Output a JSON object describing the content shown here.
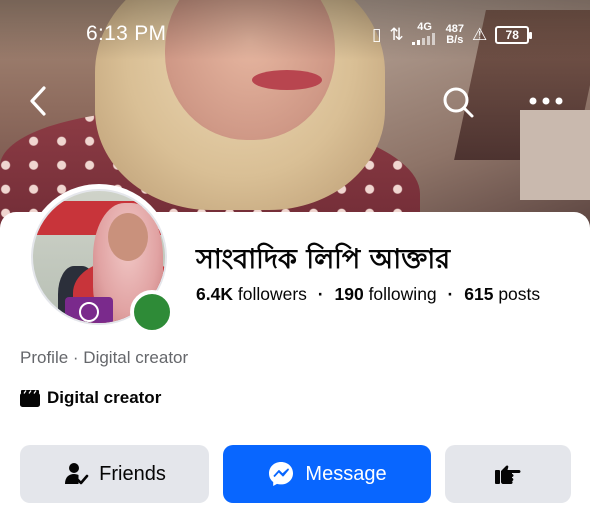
{
  "status_bar": {
    "time": "6:13 PM",
    "network_type": "4G",
    "net_speed_value": "487",
    "net_speed_unit": "B/s",
    "battery": "78"
  },
  "profile": {
    "name": "সাংবাদিক লিপি আক্তার",
    "followers_count": "6.4K",
    "followers_label": "followers",
    "following_count": "190",
    "following_label": "following",
    "posts_count": "615",
    "posts_label": "posts",
    "subtitle": "Profile · Digital creator",
    "category": "Digital creator"
  },
  "actions": {
    "friends_label": "Friends",
    "message_label": "Message"
  },
  "icons": {
    "back": "chevron-left-icon",
    "search": "search-icon",
    "more": "more-dots-icon",
    "friends": "person-check-icon",
    "message": "messenger-icon",
    "poke": "pointing-hand-icon",
    "category": "clapperboard-icon"
  },
  "colors": {
    "accent": "#0866ff",
    "secondary_button": "#e4e6eb",
    "online": "#2e8b37",
    "muted_text": "#65676b"
  }
}
